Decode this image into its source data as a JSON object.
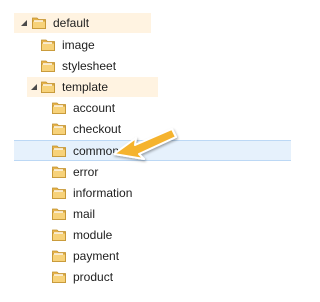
{
  "tree": {
    "root": {
      "label": "default",
      "expanded": true,
      "toggle_icon": "expanded-triangle-icon"
    },
    "root_children": [
      {
        "label": "image"
      },
      {
        "label": "stylesheet"
      }
    ],
    "template": {
      "label": "template",
      "expanded": true,
      "toggle_icon": "expanded-triangle-icon",
      "children": [
        {
          "label": "account"
        },
        {
          "label": "checkout"
        },
        {
          "label": "common",
          "selected": true
        },
        {
          "label": "error"
        },
        {
          "label": "information"
        },
        {
          "label": "mail"
        },
        {
          "label": "module"
        },
        {
          "label": "payment"
        },
        {
          "label": "product"
        }
      ]
    }
  },
  "annotation": {
    "icon": "callout-arrow-icon",
    "points_to": "common"
  },
  "colors": {
    "row_highlight": "#fff3e1",
    "selection_fill": "#e6f1fc",
    "selection_border": "#bcd8f5",
    "arrow_fill": "#f5b32f",
    "folder_yellow": "#f4c963"
  }
}
